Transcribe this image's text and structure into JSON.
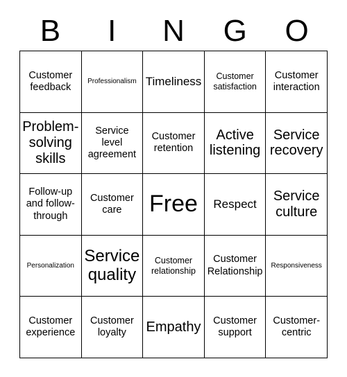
{
  "card": {
    "header_letters": [
      "B",
      "I",
      "N",
      "G",
      "O"
    ],
    "columns": 5,
    "rows": 5,
    "border_color": "#000000",
    "background_color": "#ffffff",
    "text_color": "#000000",
    "cells": [
      {
        "label": "Customer feedback",
        "size": "md"
      },
      {
        "label": "Professionalism",
        "size": "xs"
      },
      {
        "label": "Timeliness",
        "size": "lg"
      },
      {
        "label": "Customer satisfaction",
        "size": "sm"
      },
      {
        "label": "Customer interaction",
        "size": "md"
      },
      {
        "label": "Problem-solving skills",
        "size": "xl"
      },
      {
        "label": "Service level agreement",
        "size": "md"
      },
      {
        "label": "Customer retention",
        "size": "md"
      },
      {
        "label": "Active listening",
        "size": "xl"
      },
      {
        "label": "Service recovery",
        "size": "xl"
      },
      {
        "label": "Follow-up and follow-through",
        "size": "md"
      },
      {
        "label": "Customer care",
        "size": "md"
      },
      {
        "label": "Free",
        "size": "free"
      },
      {
        "label": "Respect",
        "size": "lg"
      },
      {
        "label": "Service culture",
        "size": "xl"
      },
      {
        "label": "Personalization",
        "size": "xs"
      },
      {
        "label": "Service quality",
        "size": "2xl"
      },
      {
        "label": "Customer relationship",
        "size": "sm"
      },
      {
        "label": "Customer Relationship",
        "size": "md"
      },
      {
        "label": "Responsiveness",
        "size": "xs"
      },
      {
        "label": "Customer experience",
        "size": "md"
      },
      {
        "label": "Customer loyalty",
        "size": "md"
      },
      {
        "label": "Empathy",
        "size": "xl"
      },
      {
        "label": "Customer support",
        "size": "md"
      },
      {
        "label": "Customer-centric",
        "size": "md"
      }
    ]
  }
}
